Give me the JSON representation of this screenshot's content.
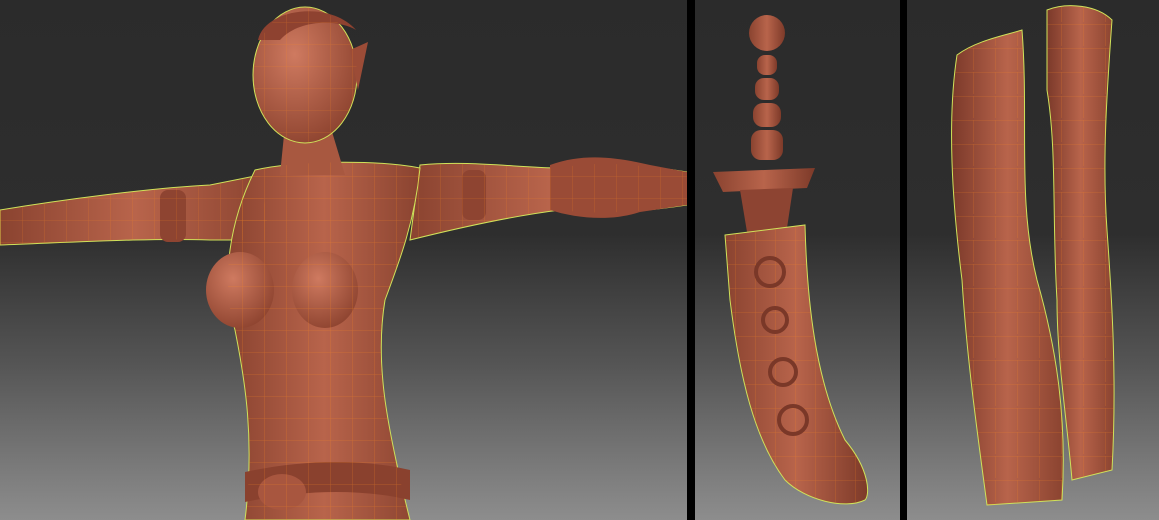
{
  "scene": {
    "panels": [
      {
        "subject": "figure-torso"
      },
      {
        "subject": "dagger-and-sheath"
      },
      {
        "subject": "cloth-strips"
      }
    ],
    "colors": {
      "clay": "#a5553f",
      "clay_light": "#c06a52",
      "clay_dark": "#6e3324",
      "wire": "#ff8a1f",
      "outline": "#cfe25a",
      "bg_top": "#2b2b2b",
      "bg_bottom": "#8d8d8d",
      "divider": "#000000"
    }
  }
}
